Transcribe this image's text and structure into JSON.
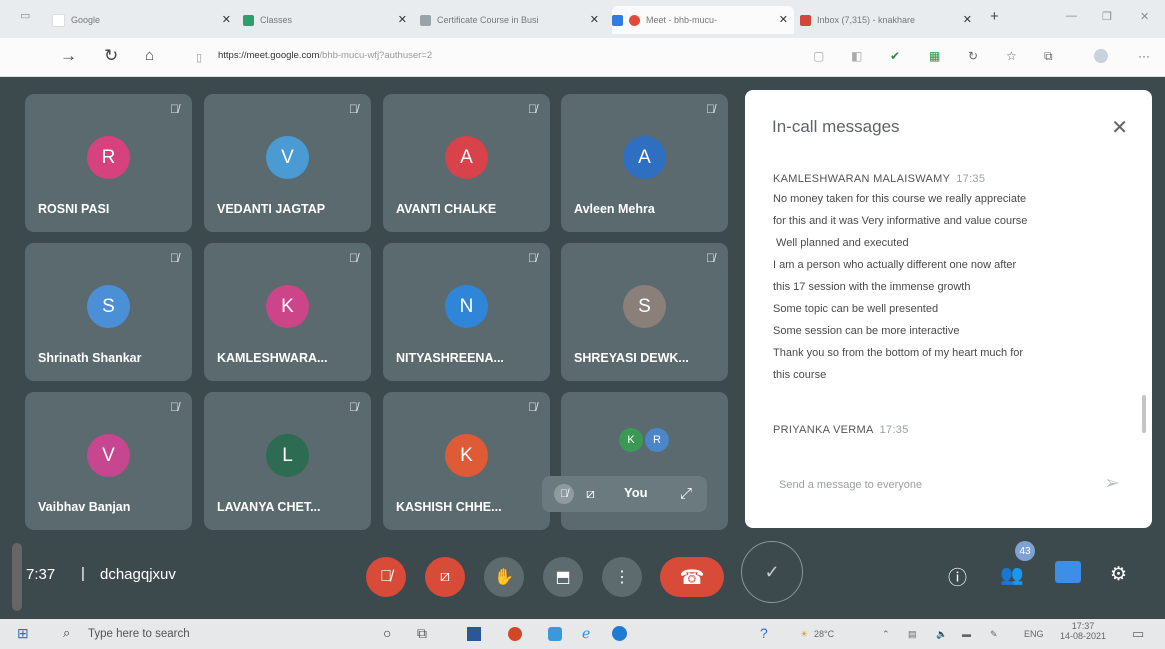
{
  "browser": {
    "tabs": [
      {
        "title": "Google"
      },
      {
        "title": "Classes"
      },
      {
        "title": "Certificate Course in Busi"
      },
      {
        "title": "Meet - bhb-mucu-"
      },
      {
        "title": "Inbox (7,315) - knakhare"
      }
    ],
    "new_tab": "+",
    "address": {
      "host": "https://meet.google.com",
      "path": "/bhb-mucu-wfj?authuser=2"
    }
  },
  "participants": [
    {
      "initial": "R",
      "name": "ROSNI PASI",
      "color": "#d6427d"
    },
    {
      "initial": "V",
      "name": "VEDANTI JAGTAP",
      "color": "#4a9ad3"
    },
    {
      "initial": "A",
      "name": "AVANTI CHALKE",
      "color": "#d7424b"
    },
    {
      "initial": "A",
      "name": "Avleen Mehra",
      "color": "#2f6fc2"
    },
    {
      "initial": "S",
      "name": "Shrinath Shankar",
      "color": "#4b90d6"
    },
    {
      "initial": "K",
      "name": "KAMLESHWARA...",
      "color": "#cc4589"
    },
    {
      "initial": "N",
      "name": "NITYASHREENA...",
      "color": "#2f86d8"
    },
    {
      "initial": "S",
      "name": "SHREYASI DEWK...",
      "color": "#8a7f79"
    },
    {
      "initial": "V",
      "name": "Vaibhav Banjan",
      "color": "#c64690"
    },
    {
      "initial": "L",
      "name": "LAVANYA CHET...",
      "color": "#2e6b53"
    },
    {
      "initial": "K",
      "name": "KASHISH CHHE...",
      "color": "#de5b35"
    }
  ],
  "self_tile": {
    "mini_avatars": [
      {
        "initial": "K",
        "color": "#3a9a55"
      },
      {
        "initial": "R",
        "color": "#4a86c8"
      }
    ],
    "label": "You"
  },
  "chat": {
    "title": "In-call messages",
    "messages": [
      {
        "sender": "KAMLESHWARAN MALAISWAMY",
        "time": "17:35",
        "lines": [
          "No money taken for this course we really appreciate",
          "for this and it was Very informative and value course",
          " Well planned and executed",
          "I am a person who actually different one now after",
          "this 17 session with the immense growth",
          "Some topic can be well presented",
          "Some session can be more interactive",
          "Thank you so from the bottom of my heart much for",
          "this course"
        ]
      },
      {
        "sender": "PRIYANKA VERMA",
        "time": "17:35",
        "lines": []
      }
    ],
    "input_placeholder": "Send a message to everyone"
  },
  "meeting": {
    "time": "7:37",
    "code": "dchagqjxuv"
  },
  "controls": {
    "people_count": "43"
  },
  "taskbar": {
    "search_placeholder": "Type here to search",
    "temperature": "28°C",
    "language": "ENG",
    "time": "17:37",
    "date": "14-08-2021"
  }
}
